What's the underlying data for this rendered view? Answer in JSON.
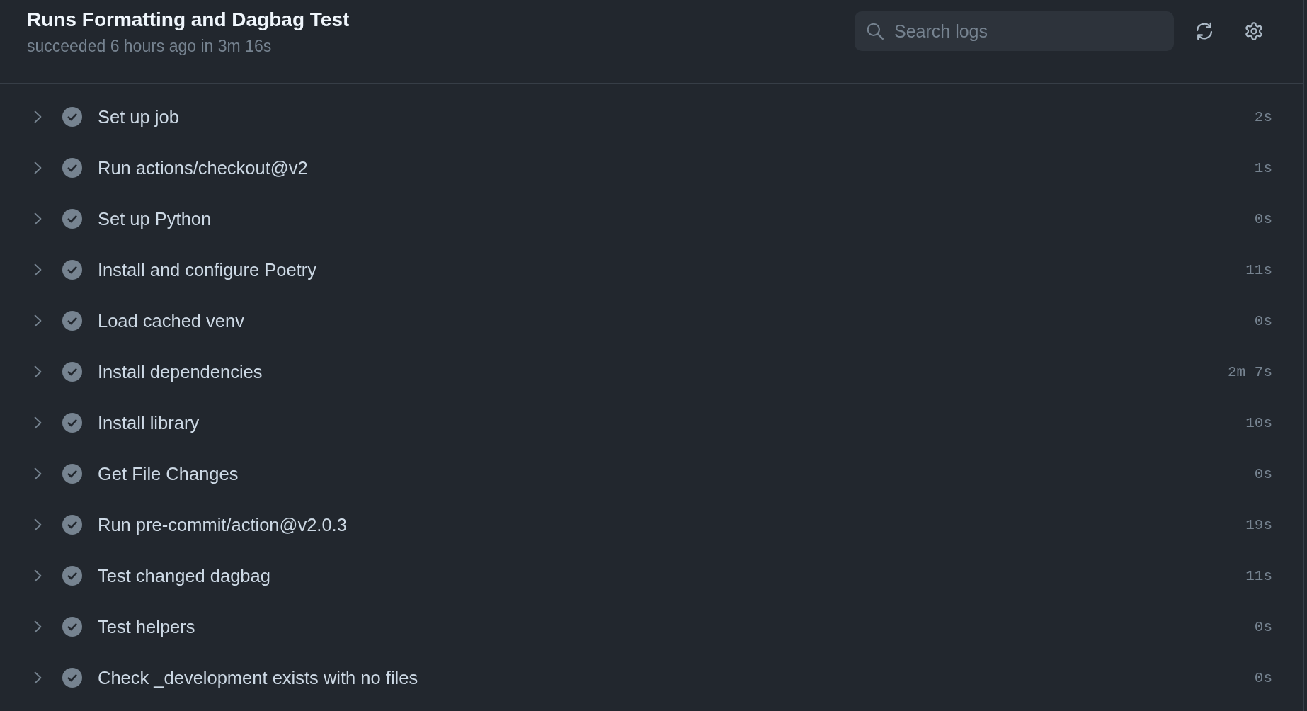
{
  "header": {
    "title": "Runs Formatting and Dagbag Test",
    "subtitle": "succeeded 6 hours ago in 3m 16s"
  },
  "search": {
    "placeholder": "Search logs"
  },
  "steps": [
    {
      "name": "Set up job",
      "duration": "2s",
      "kind": "success",
      "expanded": false
    },
    {
      "name": "Run actions/checkout@v2",
      "duration": "1s",
      "kind": "success",
      "expanded": false
    },
    {
      "name": "Set up Python",
      "duration": "0s",
      "kind": "success",
      "expanded": false
    },
    {
      "name": "Install and configure Poetry",
      "duration": "11s",
      "kind": "success",
      "expanded": false
    },
    {
      "name": "Load cached venv",
      "duration": "0s",
      "kind": "success",
      "expanded": false
    },
    {
      "name": "Install dependencies",
      "duration": "2m 7s",
      "kind": "success",
      "expanded": false
    },
    {
      "name": "Install library",
      "duration": "10s",
      "kind": "success",
      "expanded": false
    },
    {
      "name": "Get File Changes",
      "duration": "0s",
      "kind": "success",
      "expanded": false
    },
    {
      "name": "Run pre-commit/action@v2.0.3",
      "duration": "19s",
      "kind": "success",
      "expanded": false
    },
    {
      "name": "Test changed dagbag",
      "duration": "11s",
      "kind": "success",
      "expanded": false
    },
    {
      "name": "Test helpers",
      "duration": "0s",
      "kind": "success",
      "expanded": false
    },
    {
      "name": "Check _development exists with no files",
      "duration": "0s",
      "kind": "success",
      "expanded": false
    }
  ]
}
